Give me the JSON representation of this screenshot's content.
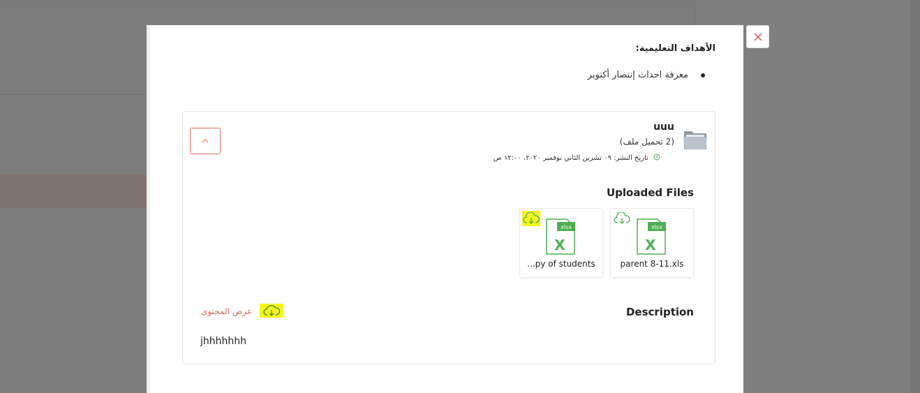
{
  "modal": {
    "goals_title": "الأهداف التعليمية:",
    "goal_item": "معرفة احداث إنتصار أكتوبر"
  },
  "card": {
    "title": "uuu",
    "count": "(2 تحميل ملف)",
    "date": "تاريخ النشر: ٠٩ تشرين الثاني نوفمبر ٢٠٢٠، ١٢:٠٠ ص",
    "uploaded_title": "Uploaded Files",
    "files": [
      {
        "name": "parent 8-11.xls",
        "ext": "xlsx"
      },
      {
        "name": "...py of students",
        "ext": "xlsx"
      }
    ],
    "description_title": "Description",
    "view_content": "عرض المحتوى",
    "description_text": "jhhhhhhh"
  },
  "colors": {
    "accent": "#e06a5a",
    "excel": "#4caf50",
    "highlight": "#f5f51a"
  }
}
